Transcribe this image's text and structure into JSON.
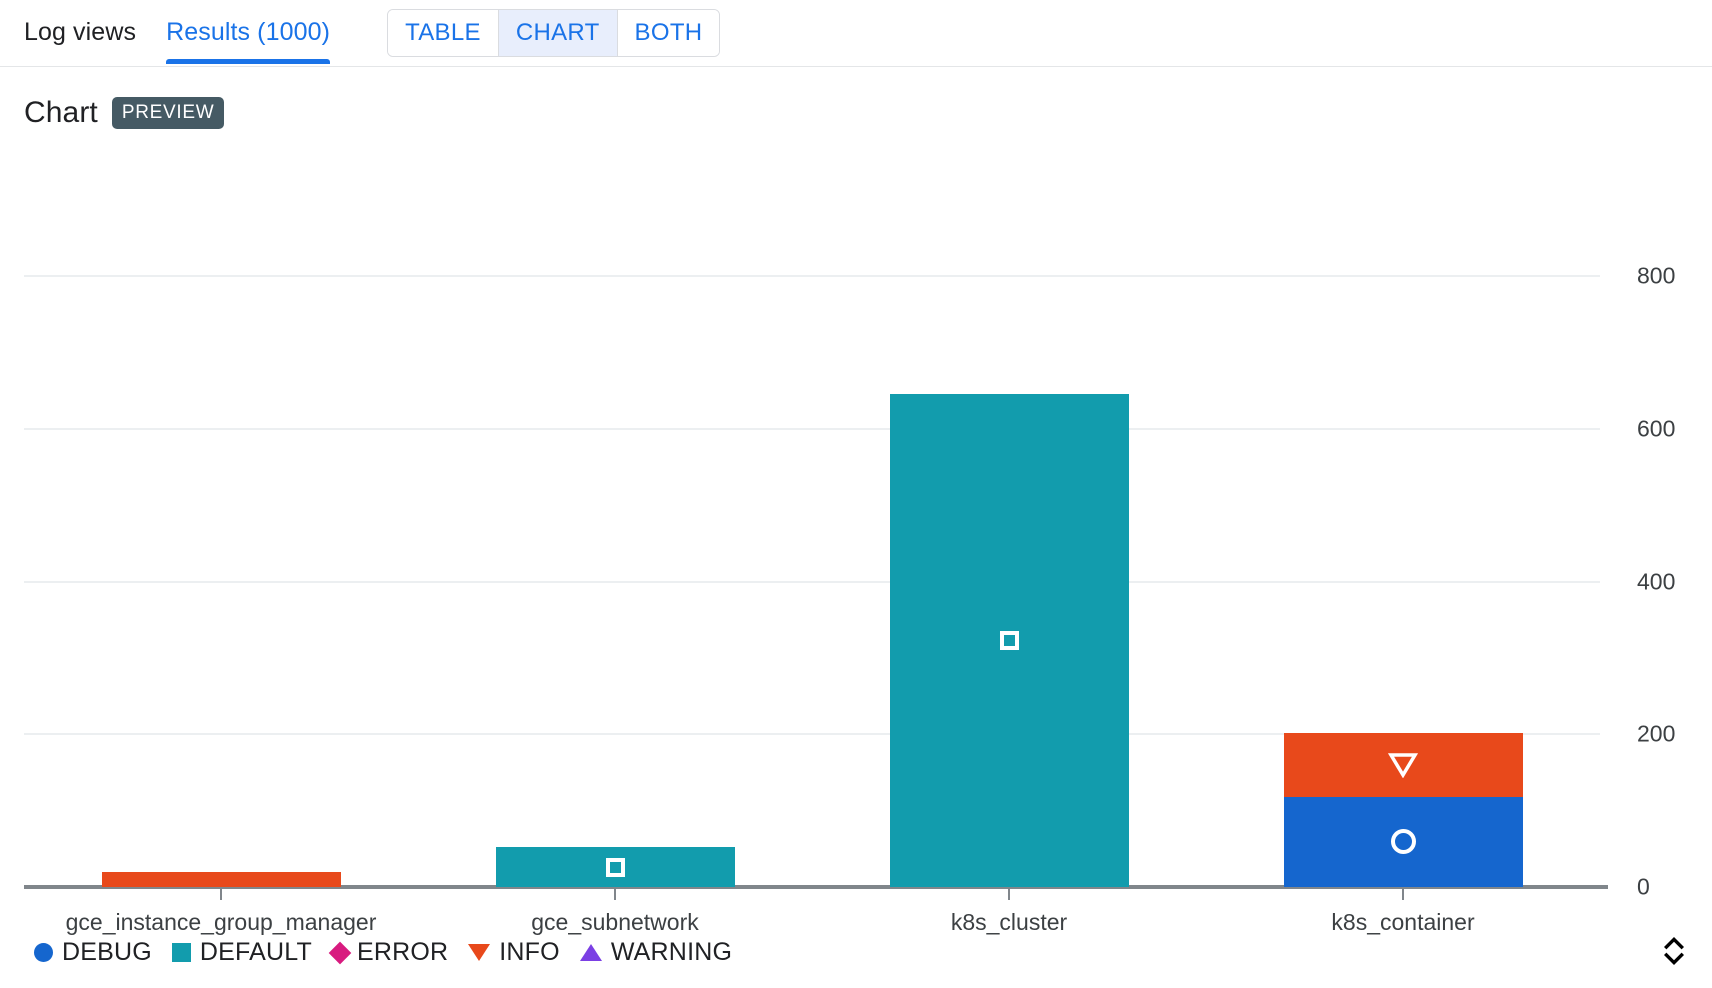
{
  "header": {
    "tabs": [
      {
        "label": "Log views",
        "active": false
      },
      {
        "label": "Results (1000)",
        "active": true
      }
    ],
    "view_toggle": {
      "options": [
        "TABLE",
        "CHART",
        "BOTH"
      ],
      "selected": "CHART"
    },
    "accent_color": "#1a73e8"
  },
  "chart_panel": {
    "title": "Chart",
    "badge": "PREVIEW",
    "badge_color": "#455a64",
    "expand_icon": "chevron-up-down-icon"
  },
  "chart_data": {
    "type": "bar",
    "stacked": true,
    "title": "Chart",
    "xlabel": "",
    "ylabel": "",
    "ylim": [
      0,
      800
    ],
    "yticks": [
      0,
      200,
      400,
      600,
      800
    ],
    "grid": true,
    "legend_position": "bottom-left",
    "categories": [
      "gce_instance_group_manager",
      "gce_subnetwork",
      "k8s_cluster",
      "k8s_container"
    ],
    "series": [
      {
        "name": "DEBUG",
        "color": "#1566ce",
        "marker": "circle",
        "values": [
          0,
          0,
          0,
          118
        ]
      },
      {
        "name": "DEFAULT",
        "color": "#129cad",
        "marker": "square",
        "values": [
          0,
          52,
          645,
          0
        ]
      },
      {
        "name": "ERROR",
        "color": "#d81b7f",
        "marker": "diamond",
        "values": [
          0,
          0,
          0,
          0
        ]
      },
      {
        "name": "INFO",
        "color": "#e8491b",
        "marker": "triangle-down",
        "values": [
          20,
          0,
          0,
          84
        ]
      },
      {
        "name": "WARNING",
        "color": "#7b3fe4",
        "marker": "triangle-up",
        "values": [
          0,
          0,
          0,
          0
        ]
      }
    ],
    "legend": [
      {
        "label": "DEBUG",
        "color": "#1566ce",
        "marker": "circle"
      },
      {
        "label": "DEFAULT",
        "color": "#129cad",
        "marker": "square"
      },
      {
        "label": "ERROR",
        "color": "#d81b7f",
        "marker": "diamond"
      },
      {
        "label": "INFO",
        "color": "#e8491b",
        "marker": "triangle-down"
      },
      {
        "label": "WARNING",
        "color": "#7b3fe4",
        "marker": "triangle-up"
      }
    ]
  }
}
